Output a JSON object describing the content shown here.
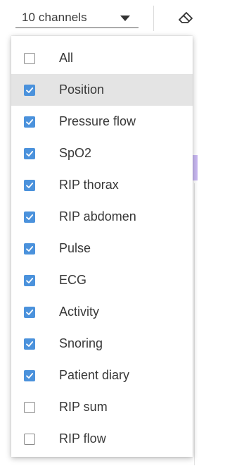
{
  "select": {
    "label": "10 channels"
  },
  "menu": {
    "items": [
      {
        "label": "All",
        "checked": false
      },
      {
        "label": "Position",
        "checked": true,
        "highlighted": true
      },
      {
        "label": "Pressure flow",
        "checked": true
      },
      {
        "label": "SpO2",
        "checked": true
      },
      {
        "label": "RIP thorax",
        "checked": true
      },
      {
        "label": "RIP abdomen",
        "checked": true
      },
      {
        "label": "Pulse",
        "checked": true
      },
      {
        "label": "ECG",
        "checked": true
      },
      {
        "label": "Activity",
        "checked": true
      },
      {
        "label": "Snoring",
        "checked": true
      },
      {
        "label": "Patient diary",
        "checked": true
      },
      {
        "label": "RIP sum",
        "checked": false
      },
      {
        "label": "RIP flow",
        "checked": false
      }
    ]
  },
  "colors": {
    "checkbox_checked": "#4b92dc",
    "highlight": "#e4e4e4"
  },
  "icons": {
    "select_arrow": "chevron-down-icon",
    "clear": "eraser-icon"
  }
}
